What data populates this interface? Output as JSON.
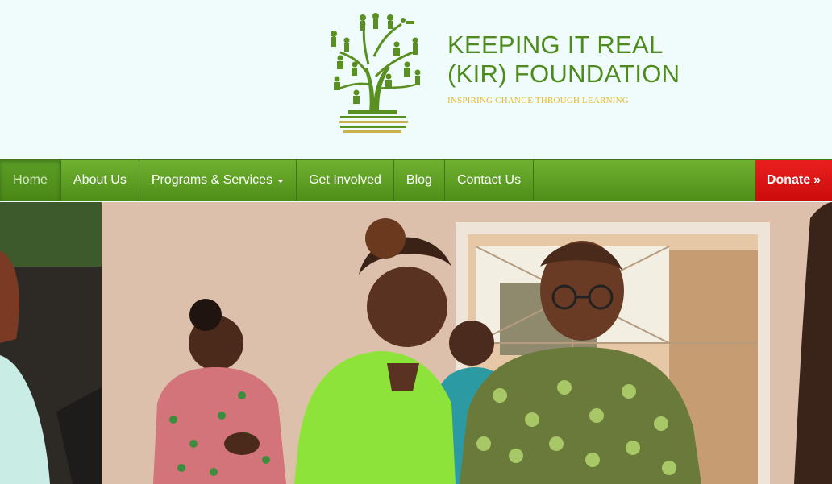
{
  "brand": {
    "title": "KEEPING IT REAL\n(KIR) FOUNDATION",
    "tagline": "INSPIRING CHANGE THROUGH LEARNING"
  },
  "nav": {
    "items": [
      {
        "label": "Home",
        "active": true
      },
      {
        "label": "About Us"
      },
      {
        "label": "Programs & Services",
        "dropdown": true
      },
      {
        "label": "Get Involved"
      },
      {
        "label": "Blog"
      },
      {
        "label": "Contact Us"
      }
    ],
    "donate_label": "Donate",
    "donate_icon": "double-chevron-right-icon"
  },
  "colors": {
    "brand_green": "#4e8a1d",
    "tagline_gold": "#e7b928",
    "nav_green": "#5c9e27",
    "donate_red": "#e0161a"
  }
}
